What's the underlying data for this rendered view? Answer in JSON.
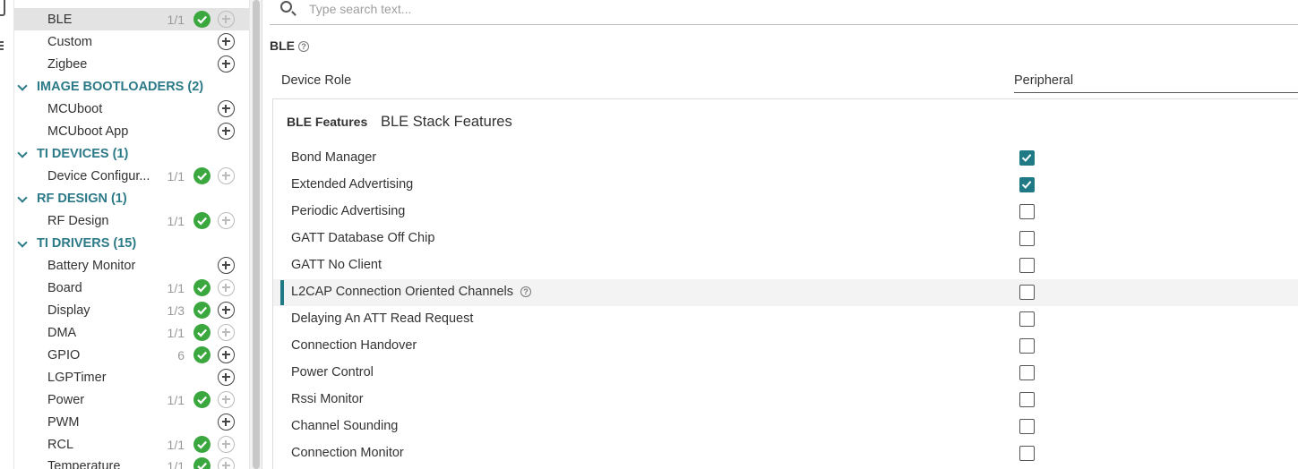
{
  "sidebar": {
    "categories": [
      {
        "label": "IMAGE BOOTLOADERS (2)"
      },
      {
        "label": "TI DEVICES (1)"
      },
      {
        "label": "RF DESIGN (1)"
      },
      {
        "label": "TI DRIVERS (15)"
      }
    ],
    "items": [
      {
        "label": "BLE",
        "count": "1/1"
      },
      {
        "label": "Custom",
        "count": ""
      },
      {
        "label": "Zigbee",
        "count": ""
      },
      {
        "label": "MCUboot",
        "count": ""
      },
      {
        "label": "MCUboot App",
        "count": ""
      },
      {
        "label": "Device Configur...",
        "count": "1/1"
      },
      {
        "label": "RF Design",
        "count": "1/1"
      },
      {
        "label": "Battery Monitor",
        "count": ""
      },
      {
        "label": "Board",
        "count": "1/1"
      },
      {
        "label": "Display",
        "count": "1/3"
      },
      {
        "label": "DMA",
        "count": "1/1"
      },
      {
        "label": "GPIO",
        "count": "6"
      },
      {
        "label": "LGPTimer",
        "count": ""
      },
      {
        "label": "Power",
        "count": "1/1"
      },
      {
        "label": "PWM",
        "count": ""
      },
      {
        "label": "RCL",
        "count": "1/1"
      },
      {
        "label": "Temperature",
        "count": "1/1"
      }
    ]
  },
  "search": {
    "placeholder": "Type search text..."
  },
  "main": {
    "section_title": "BLE",
    "device_role": {
      "label": "Device Role",
      "value": "Peripheral"
    },
    "features": {
      "title": "BLE Features",
      "subtitle": "BLE Stack Features",
      "rows": [
        {
          "label": "Bond Manager",
          "checked": true
        },
        {
          "label": "Extended Advertising",
          "checked": true
        },
        {
          "label": "Periodic Advertising",
          "checked": false
        },
        {
          "label": "GATT Database Off Chip",
          "checked": false
        },
        {
          "label": "GATT No Client",
          "checked": false
        },
        {
          "label": "L2CAP Connection Oriented Channels",
          "checked": false
        },
        {
          "label": "Delaying An ATT Read Request",
          "checked": false
        },
        {
          "label": "Connection Handover",
          "checked": false
        },
        {
          "label": "Power Control",
          "checked": false
        },
        {
          "label": "Rssi Monitor",
          "checked": false
        },
        {
          "label": "Channel Sounding",
          "checked": false
        },
        {
          "label": "Connection Monitor",
          "checked": false
        }
      ]
    }
  },
  "colors": {
    "accent": "#1f7a86",
    "category": "#2c7a88",
    "ok": "#3ba73f"
  }
}
